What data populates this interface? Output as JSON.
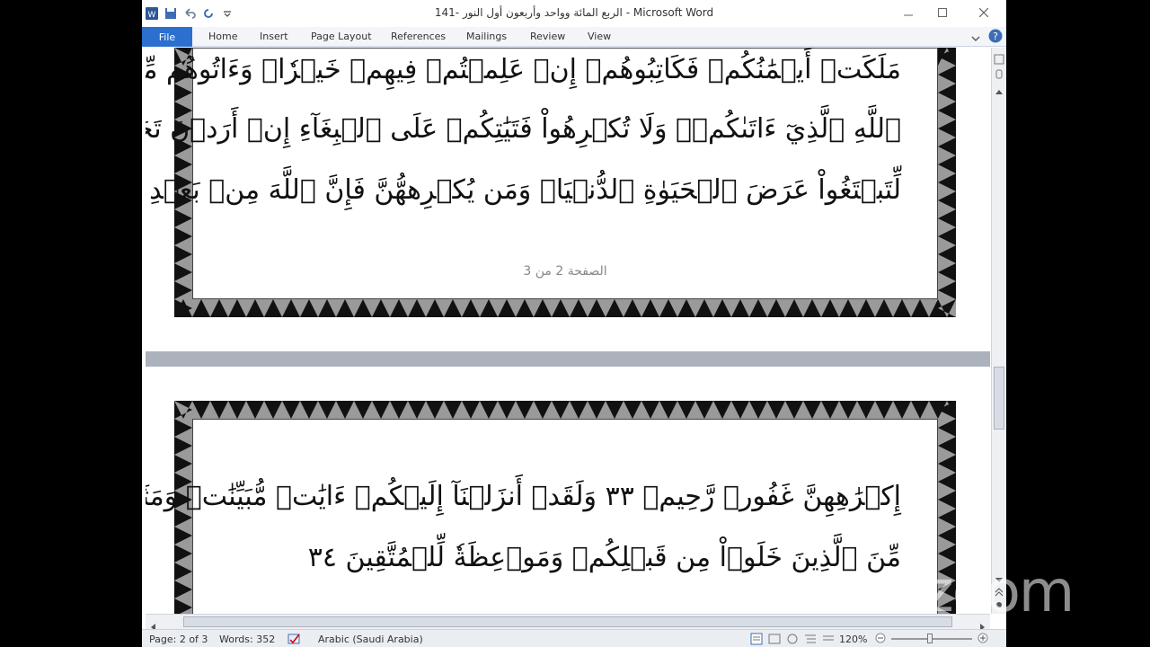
{
  "window": {
    "title": "الربع المائة وواحد وأربعون أول النور -141 - Microsoft Word"
  },
  "ribbon": {
    "file": "File",
    "tabs": [
      "Home",
      "Insert",
      "Page Layout",
      "References",
      "Mailings",
      "Review",
      "View"
    ]
  },
  "document": {
    "page_top_lines": [
      "مَلَكَتۡ أَيۡمَٰنُكُمۡ فَكَاتِبُوهُمۡ إِنۡ عَلِمۡتُمۡ فِيهِمۡ خَيۡرٗاۖ وَءَاتُوهُم مِّن مَّالِ",
      "ٱللَّهِ ٱلَّذِيٓ ءَاتَىٰكُمۡۚ وَلَا تُكۡرِهُواْ فَتَيَٰتِكُمۡ عَلَى ٱلۡبِغَآءِ إِنۡ أَرَدۡنَ تَحَصُّنٗا",
      "لِّتَبۡتَغُواْ عَرَضَ ٱلۡحَيَوٰةِ ٱلدُّنۡيَاۚ وَمَن يُكۡرِههُّنَّ فَإِنَّ ٱللَّهَ مِنۢ بَعۡدِ"
    ],
    "page_number_text": "الصفحة 2 من 3",
    "page_bottom_lines": [
      "إِكۡرَٰهِهِنَّ غَفُورٞ رَّحِيمٞ ٣٣ وَلَقَدۡ أَنزَلۡنَآ إِلَيۡكُمۡ ءَايَٰتٖ مُّبَيِّنَٰتٖ وَمَثَلٗا",
      "مِّنَ ٱلَّذِينَ خَلَوۡاْ مِن قَبۡلِكُمۡ وَمَوۡعِظَةٗ لِّلۡمُتَّقِينَ ٣٤"
    ]
  },
  "status": {
    "page": "Page: 2 of 3",
    "words": "Words: 352",
    "language": "Arabic (Saudi Arabia)",
    "zoom": "120%"
  },
  "overlay": {
    "logo": "zoom"
  },
  "colors": {
    "accent": "#2b6fcf",
    "verse_red": "#e0201e"
  }
}
